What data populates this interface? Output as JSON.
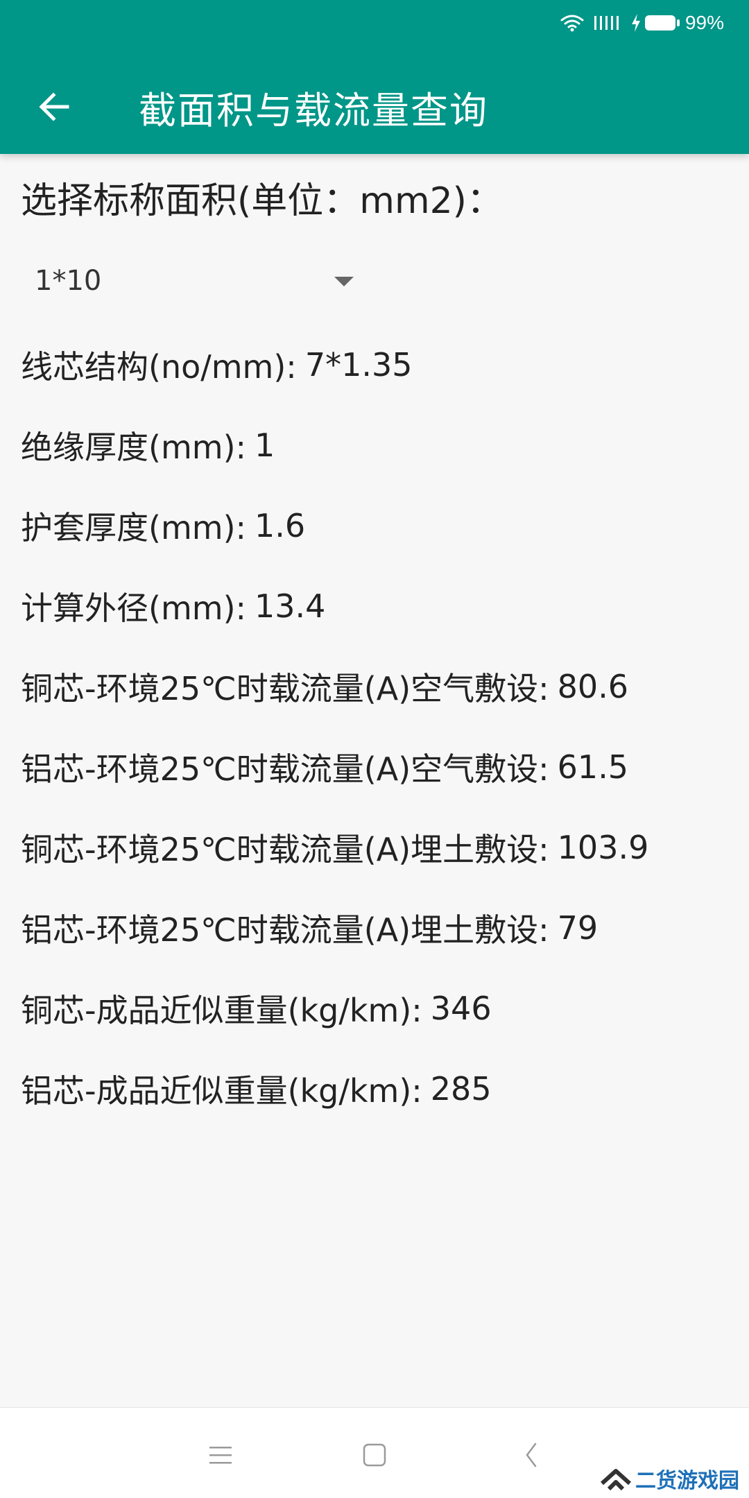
{
  "status_bar": {
    "battery_text": "99%"
  },
  "app_bar": {
    "title": "截面积与载流量查询"
  },
  "selector": {
    "label": "选择标称面积(单位：mm2)：",
    "selected_value": "1*10"
  },
  "rows": [
    {
      "label": "线芯结构(no/mm):",
      "value": "7*1.35"
    },
    {
      "label": "绝缘厚度(mm):",
      "value": "1"
    },
    {
      "label": "护套厚度(mm):",
      "value": "1.6"
    },
    {
      "label": "计算外径(mm):",
      "value": "13.4"
    },
    {
      "label": "铜芯-环境25℃时载流量(A)空气敷设:",
      "value": "80.6"
    },
    {
      "label": "铝芯-环境25℃时载流量(A)空气敷设:",
      "value": "61.5"
    },
    {
      "label": "铜芯-环境25℃时载流量(A)埋土敷设:",
      "value": "103.9"
    },
    {
      "label": "铝芯-环境25℃时载流量(A)埋土敷设:",
      "value": "79"
    },
    {
      "label": "铜芯-成品近似重量(kg/km):",
      "value": "346"
    },
    {
      "label": "铝芯-成品近似重量(kg/km):",
      "value": "285"
    }
  ],
  "watermark": {
    "text": "二货游戏园"
  },
  "colors": {
    "app_bar": "#009688",
    "background": "#f7f7f7",
    "watermark": "#1e70b8"
  },
  "icons": {
    "back": "arrow-left-icon",
    "wifi": "wifi-icon",
    "signal": "signal-icon",
    "charging": "charging-bolt-icon",
    "battery": "battery-icon",
    "dropdown": "caret-down-icon",
    "nav_menu": "menu-icon",
    "nav_home": "home-square-icon",
    "nav_back": "chevron-left-icon"
  }
}
